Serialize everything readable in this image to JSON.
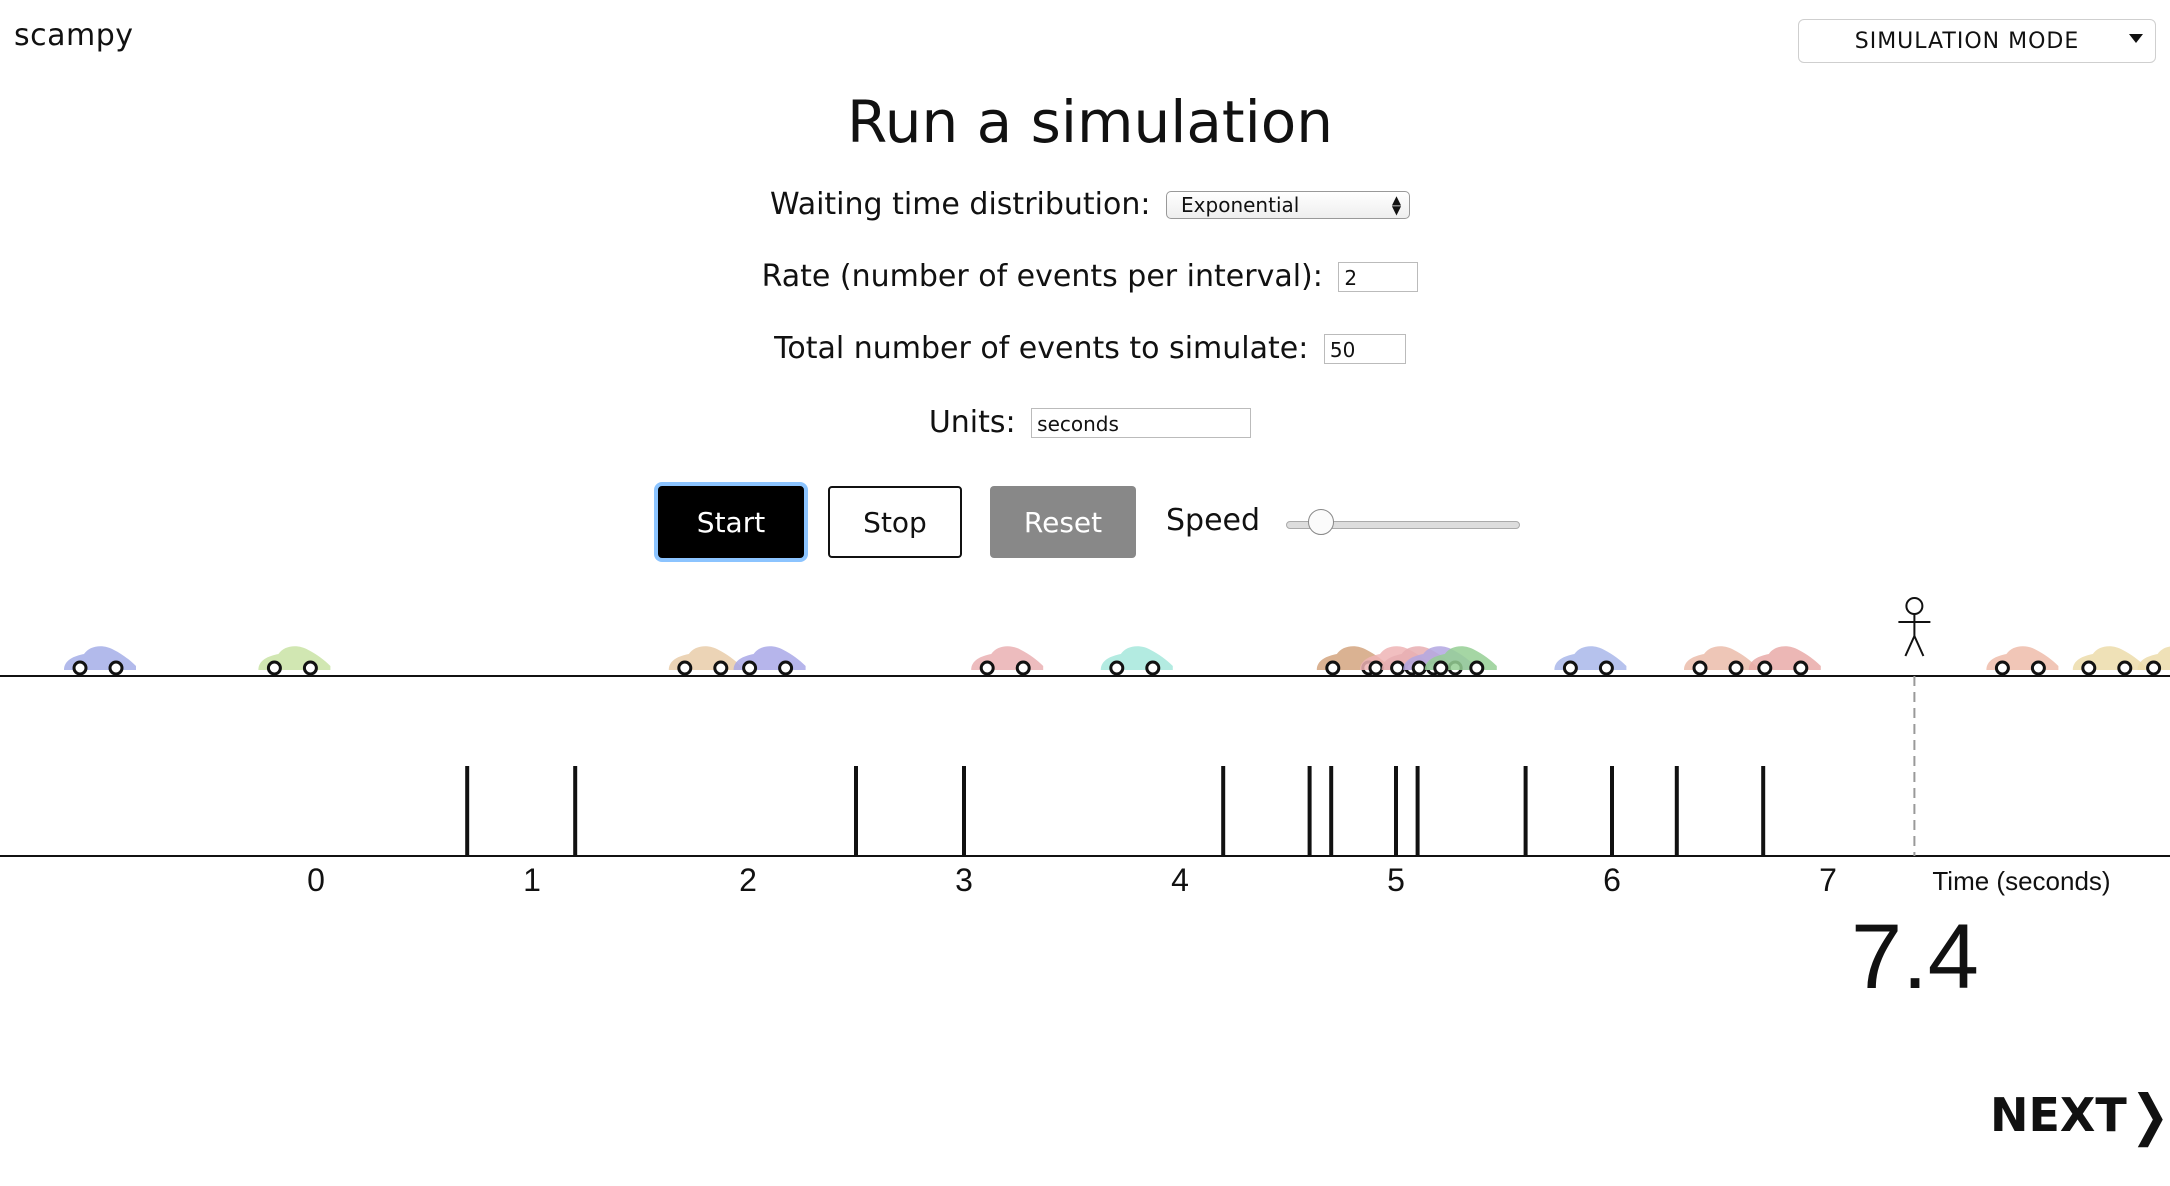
{
  "header": {
    "brand": "scampy",
    "mode_select": "SIMULATION MODE"
  },
  "main": {
    "title": "Run a simulation",
    "distribution": {
      "label": "Waiting time distribution:",
      "value": "Exponential"
    },
    "rate": {
      "label": "Rate (number of events per interval):",
      "value": "2"
    },
    "total_events": {
      "label": "Total number of events to simulate:",
      "value": "50"
    },
    "units": {
      "label": "Units:",
      "value": "seconds"
    },
    "controls": {
      "start": "Start",
      "stop": "Stop",
      "reset": "Reset",
      "speed_label": "Speed",
      "speed_value": 0.15
    }
  },
  "timeline": {
    "axis_label": "Time (seconds)",
    "ticks": [
      "0",
      "1",
      "2",
      "3",
      "4",
      "5",
      "6",
      "7"
    ],
    "event_times": [
      0.7,
      1.2,
      2.5,
      3.0,
      4.2,
      4.6,
      4.7,
      5.0,
      5.1,
      5.6,
      6.0,
      6.3,
      6.7
    ],
    "current_time": "7.4",
    "current_time_value": 7.4,
    "cars": [
      {
        "t": -1.0,
        "color": "#a5aee8"
      },
      {
        "t": -0.1,
        "color": "#c9e3a4"
      },
      {
        "t": 1.8,
        "color": "#e9cda9"
      },
      {
        "t": 2.1,
        "color": "#a9a8e8"
      },
      {
        "t": 3.2,
        "color": "#eab0b3"
      },
      {
        "t": 3.8,
        "color": "#a6e7dc"
      },
      {
        "t": 4.8,
        "color": "#d4a47f"
      },
      {
        "t": 5.0,
        "color": "#efb4b5"
      },
      {
        "t": 5.1,
        "color": "#e7aeb2"
      },
      {
        "t": 5.2,
        "color": "#b3a7e2"
      },
      {
        "t": 5.3,
        "color": "#95cf94"
      },
      {
        "t": 5.9,
        "color": "#a9b7ea"
      },
      {
        "t": 6.5,
        "color": "#ebbcaa"
      },
      {
        "t": 6.8,
        "color": "#e9aaa8"
      },
      {
        "t": 7.9,
        "color": "#eebcaa"
      },
      {
        "t": 8.3,
        "color": "#ecdcaa"
      },
      {
        "t": 8.6,
        "color": "#ecdcaa"
      }
    ]
  },
  "footer": {
    "next": "NEXT"
  }
}
